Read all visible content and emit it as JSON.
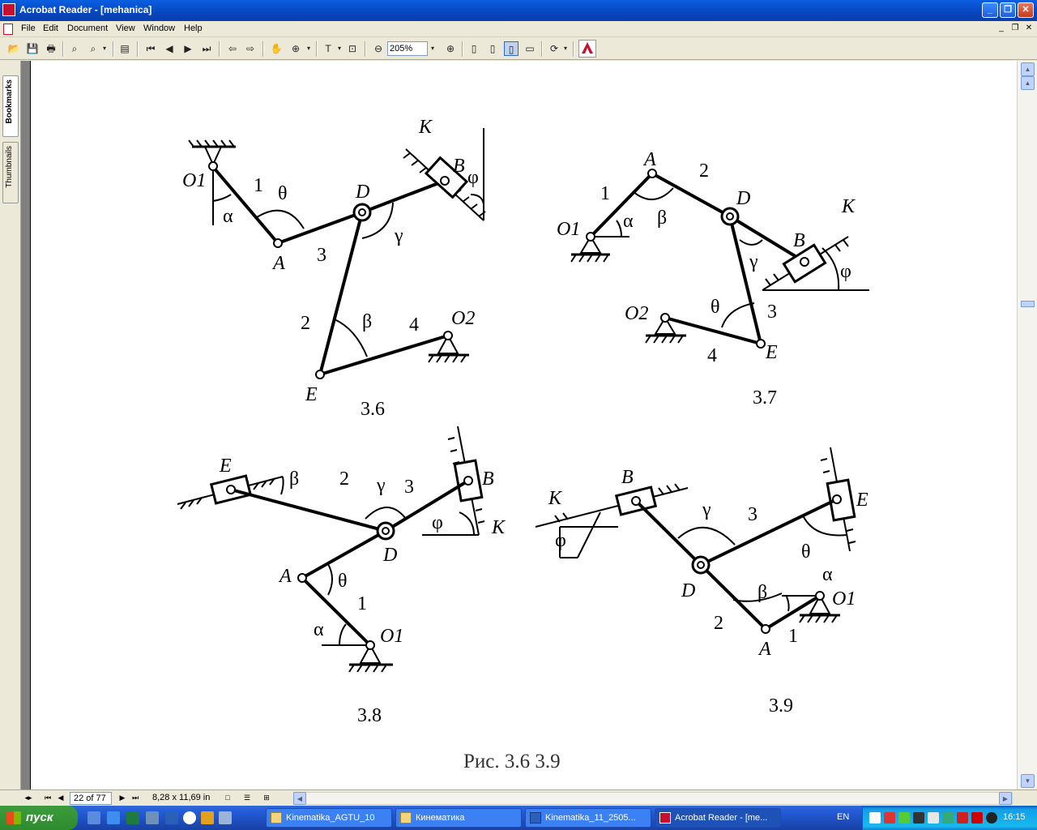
{
  "window": {
    "title": "Acrobat Reader - [mehanica]"
  },
  "menu": {
    "items": [
      "File",
      "Edit",
      "Document",
      "View",
      "Window",
      "Help"
    ]
  },
  "toolbar": {
    "zoom_value": "205%"
  },
  "left_panel": {
    "tabs": [
      "Bookmarks",
      "Thumbnails"
    ]
  },
  "status": {
    "page": "22 of 77",
    "page_size": "8,28 x 11,69 in"
  },
  "document": {
    "figures": [
      {
        "number": "3.6",
        "points": [
          "O1",
          "A",
          "D",
          "B",
          "K",
          "E",
          "O2"
        ],
        "links": [
          "1",
          "2",
          "3",
          "4"
        ],
        "angles": [
          "α",
          "θ",
          "γ",
          "β",
          "φ"
        ]
      },
      {
        "number": "3.7",
        "points": [
          "A",
          "O1",
          "D",
          "B",
          "K",
          "O2",
          "E"
        ],
        "links": [
          "1",
          "2",
          "3",
          "4"
        ],
        "angles": [
          "α",
          "β",
          "γ",
          "θ",
          "φ"
        ]
      },
      {
        "number": "3.8",
        "points": [
          "E",
          "B",
          "K",
          "D",
          "A",
          "O1"
        ],
        "links": [
          "1",
          "2",
          "3"
        ],
        "angles": [
          "β",
          "γ",
          "φ",
          "θ",
          "α"
        ]
      },
      {
        "number": "3.9",
        "points": [
          "K",
          "B",
          "E",
          "D",
          "A",
          "O1"
        ],
        "links": [
          "1",
          "2",
          "3"
        ],
        "angles": [
          "φ",
          "γ",
          "θ",
          "β",
          "α"
        ]
      }
    ],
    "caption": "Рис. 3.6  3.9"
  },
  "taskbar": {
    "start": "пуск",
    "tasks": [
      "Kinematika_AGTU_10",
      "Кинематика",
      "Kinematika_11_2505...",
      "Acrobat Reader - [me..."
    ],
    "language": "EN",
    "clock": "16:15"
  },
  "colors": {
    "titlebar": "#0a5fe0",
    "taskbar": "#245edb",
    "start": "#2e8b2e",
    "page": "#ffffff"
  }
}
